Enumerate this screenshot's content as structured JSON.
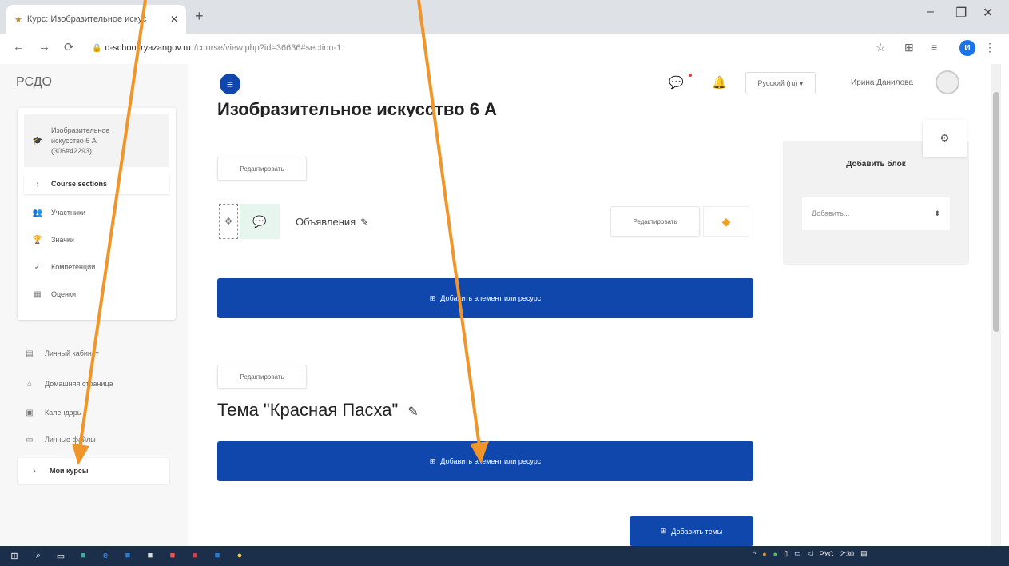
{
  "browser": {
    "tab_title": "Курс: Изобразительное искус",
    "url_domain": "d-school.ryazangov.ru",
    "url_path": "/course/view.php?id=36636#section-1",
    "profile_initial": "И"
  },
  "sidebar": {
    "brand": "РСДО",
    "course_item": "Изобразительное искусство 6 А (306#42293)",
    "course_sections": "Course sections",
    "items": [
      "Участники",
      "Значки",
      "Компетенции",
      "Оценки"
    ],
    "nav": [
      "Личный кабинет",
      "Домашняя страница",
      "Календарь",
      "Личные файлы"
    ],
    "my_courses": "Мои курсы"
  },
  "header": {
    "language": "Русский (ru) ▾",
    "user": "Ирина Данилова"
  },
  "main": {
    "title": "Изобразительное искусство 6 А",
    "edit_label": "Редактировать",
    "activity_name": "Объявления",
    "activity_edit": "Редактировать",
    "add_activity": "Добавить элемент или ресурс",
    "topic_title": "Тема \"Красная Пасха\"",
    "add_topics": "Добавить темы"
  },
  "blocks": {
    "title": "Добавить блок",
    "select_placeholder": "Добавить..."
  },
  "taskbar": {
    "lang": "РУС",
    "time": "2:30"
  },
  "colors": {
    "primary": "#0f47ad",
    "annotation_arrow": "#f0952a"
  }
}
